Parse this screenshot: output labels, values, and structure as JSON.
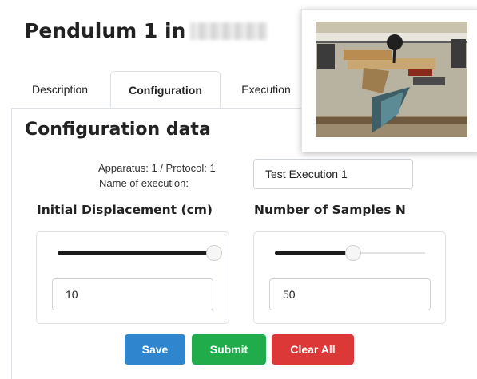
{
  "page": {
    "title": "Pendulum 1 in"
  },
  "tabs": [
    {
      "label": "Description",
      "active": false
    },
    {
      "label": "Configuration",
      "active": true
    },
    {
      "label": "Execution",
      "active": false
    }
  ],
  "config": {
    "section_title": "Configuration data",
    "apparatus_line": "Apparatus: 1 / Protocol: 1",
    "name_label": "Name of execution:",
    "execution_name": "Test Execution 1"
  },
  "fields": {
    "displacement": {
      "label": "Initial Displacement (cm)",
      "value": "10",
      "slider_fraction": 1.0
    },
    "samples": {
      "label": "Number of Samples N",
      "value": "50",
      "slider_fraction": 0.52
    }
  },
  "buttons": {
    "save": "Save",
    "submit": "Submit",
    "clear": "Clear All"
  },
  "colors": {
    "save": "#2f86cf",
    "submit": "#21ac4b",
    "clear": "#dc3838"
  }
}
